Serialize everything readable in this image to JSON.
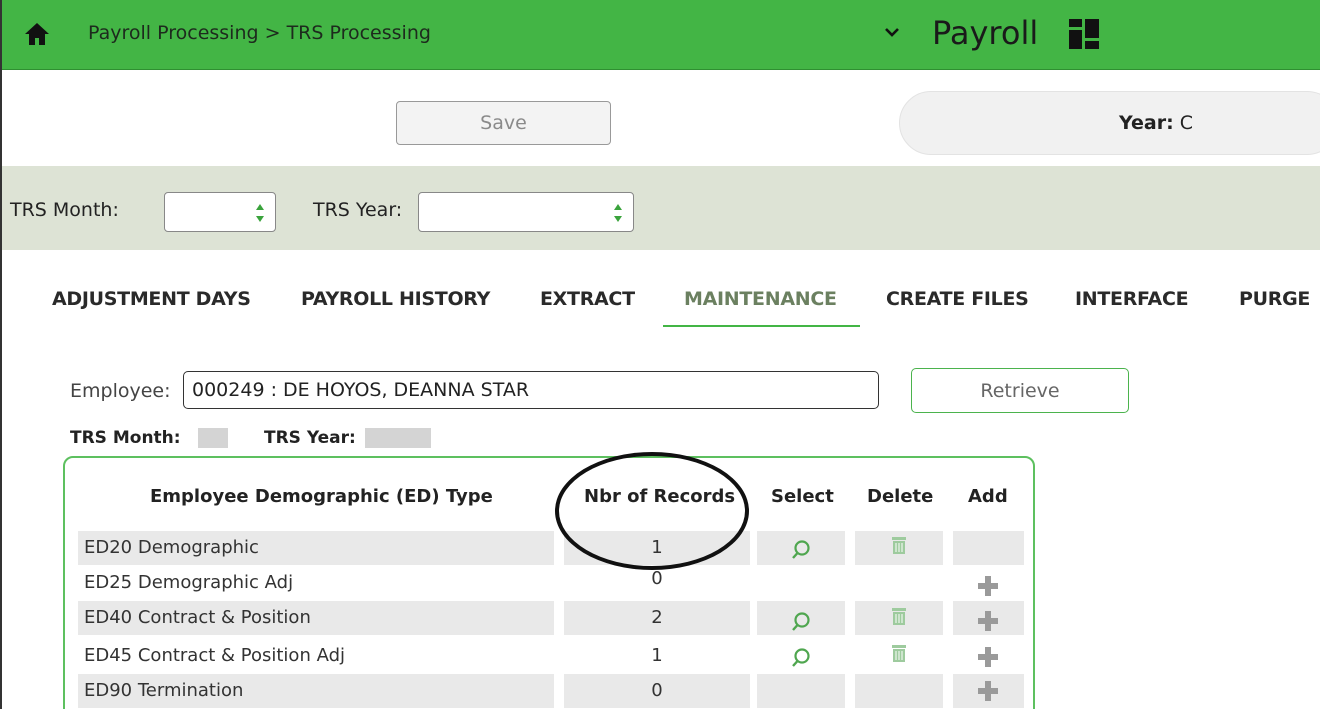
{
  "header": {
    "breadcrumb": "Payroll Processing > TRS Processing",
    "app_title": "Payroll",
    "color": "#43b545"
  },
  "toolbar": {
    "save_label": "Save",
    "year_label": "Year:",
    "year_value": "C"
  },
  "filters": {
    "trs_month_label": "TRS Month:",
    "trs_month_value": "",
    "trs_year_label": "TRS Year:",
    "trs_year_value": ""
  },
  "tabs": [
    {
      "label": "ADJUSTMENT DAYS"
    },
    {
      "label": "PAYROLL HISTORY"
    },
    {
      "label": "EXTRACT"
    },
    {
      "label": "MAINTENANCE",
      "active": true
    },
    {
      "label": "CREATE FILES"
    },
    {
      "label": "INTERFACE"
    },
    {
      "label": "PURGE"
    }
  ],
  "employee": {
    "label": "Employee:",
    "value": "000249 : DE HOYOS, DEANNA STAR",
    "retrieve_label": "Retrieve",
    "trs_month_label": "TRS Month:",
    "trs_year_label": "TRS Year:"
  },
  "table": {
    "headers": {
      "type": "Employee Demographic (ED) Type",
      "records": "Nbr of Records",
      "select": "Select",
      "delete": "Delete",
      "add": "Add"
    },
    "rows": [
      {
        "type": "ED20 Demographic",
        "records": "1",
        "select": true,
        "delete": true,
        "add": false
      },
      {
        "type": "ED25 Demographic Adj",
        "records": "0",
        "select": false,
        "delete": false,
        "add": true
      },
      {
        "type": "ED40 Contract & Position",
        "records": "2",
        "select": true,
        "delete": true,
        "add": true
      },
      {
        "type": "ED45 Contract & Position Adj",
        "records": "1",
        "select": true,
        "delete": true,
        "add": true
      },
      {
        "type": "ED90 Termination",
        "records": "0",
        "select": false,
        "delete": false,
        "add": true
      }
    ]
  },
  "icons": {
    "home": "home-icon",
    "chevron": "chevron-down-icon",
    "grid": "grid-icon",
    "select": "magnifier-icon",
    "delete": "trash-icon",
    "add": "plus-icon"
  }
}
